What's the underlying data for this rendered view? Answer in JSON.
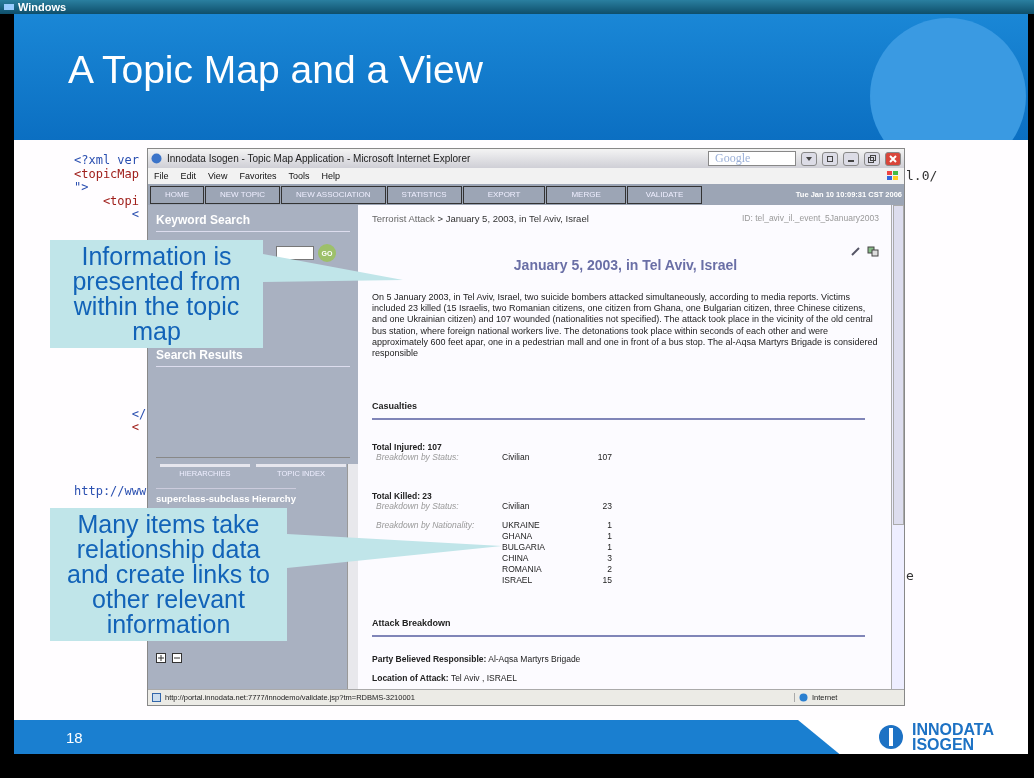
{
  "window": {
    "title": "Windows"
  },
  "slide": {
    "title": "A Topic Map and a View",
    "number": "18",
    "logo": [
      "INNODATA",
      "ISOGEN"
    ]
  },
  "code_blocks": [
    [
      "<?xml ver",
      "<topicMap",
      "\">",
      "    <topi",
      "        <"
    ],
    [
      "        </",
      "        <"
    ],
    [
      "http://www"
    ]
  ],
  "right_fragments": [
    "l.0/",
    "e"
  ],
  "browser": {
    "title": "Innodata Isogen - Topic Map Application - Microsoft Internet Explorer",
    "search_box": {
      "placeholder": "Google"
    },
    "menu": [
      "File",
      "Edit",
      "View",
      "Favorites",
      "Tools",
      "Help"
    ],
    "nav": [
      "HOME",
      "NEW TOPIC",
      "NEW ASSOCIATION",
      "STATISTICS",
      "EXPORT",
      "MERGE",
      "VALIDATE"
    ],
    "timestamp": "Tue Jan 10 10:09:31 CST 2006",
    "sidebar": {
      "keyword_title": "Keyword Search",
      "go": "GO",
      "results_title": "Search Results",
      "tabs": [
        "HIERARCHIES",
        "TOPIC INDEX"
      ],
      "hierarchy": "superclass-subclass Hierarchy"
    },
    "content": {
      "breadcrumb": {
        "parent": "Terrorist Attack",
        "separator": ">",
        "current": "January 5, 2003, in Tel Aviv, Israel"
      },
      "id": "ID: tel_aviv_il._event_5January2003",
      "heading": "January 5, 2003, in Tel Aviv, Israel",
      "paragraph": "On 5 January 2003, in Tel Aviv, Israel, two suicide bombers attacked simultaneously, according to media reports. Victims included 23 killed (15 Israelis, two Romanian citizens, one citizen from Ghana, one Bulgarian citizen, three Chinese citizens, and one Ukrainian citizen) and 107 wounded (nationalities not specified). The attack took place in the vicinity of the old central bus station, where foreign national workers live. The detonations took place within seconds of each other and were approximately 600 feet apar, one in a pedestrian mall and one in front of a bus stop. The al-Aqsa Martyrs Brigade is considered responsible",
      "casualties": {
        "title": "Casualties",
        "groups": [
          {
            "total": "Total Injured: 107",
            "breakdowns": [
              {
                "label": "Breakdown by Status:",
                "items": [
                  {
                    "name": "Civilian",
                    "count": "107"
                  }
                ]
              }
            ]
          },
          {
            "total": "Total Killed: 23",
            "breakdowns": [
              {
                "label": "Breakdown by Status:",
                "items": [
                  {
                    "name": "Civilian",
                    "count": "23"
                  }
                ]
              },
              {
                "label": "Breakdown by Nationality:",
                "items": [
                  {
                    "name": "UKRAINE",
                    "count": "1"
                  },
                  {
                    "name": "GHANA",
                    "count": "1"
                  },
                  {
                    "name": "BULGARIA",
                    "count": "1"
                  },
                  {
                    "name": "CHINA",
                    "count": "3"
                  },
                  {
                    "name": "ROMANIA",
                    "count": "2"
                  },
                  {
                    "name": "ISRAEL",
                    "count": "15"
                  }
                ]
              }
            ]
          }
        ]
      },
      "attack": {
        "title": "Attack Breakdown",
        "fields": [
          {
            "label": "Party Believed Responsible:",
            "value": "Al-Aqsa Martyrs Brigade"
          },
          {
            "label": "Location of Attack:",
            "value": "Tel Aviv , ISRAEL"
          }
        ]
      }
    },
    "status_bar": {
      "url": "http://portal.innodata.net:7777/innodemo/validate.jsp?tm=RDBMS-3210001",
      "zone": "Internet"
    }
  },
  "callouts": [
    "Information is presented from within the topic map",
    "Many items take relationship data and create links to other relevant information"
  ]
}
